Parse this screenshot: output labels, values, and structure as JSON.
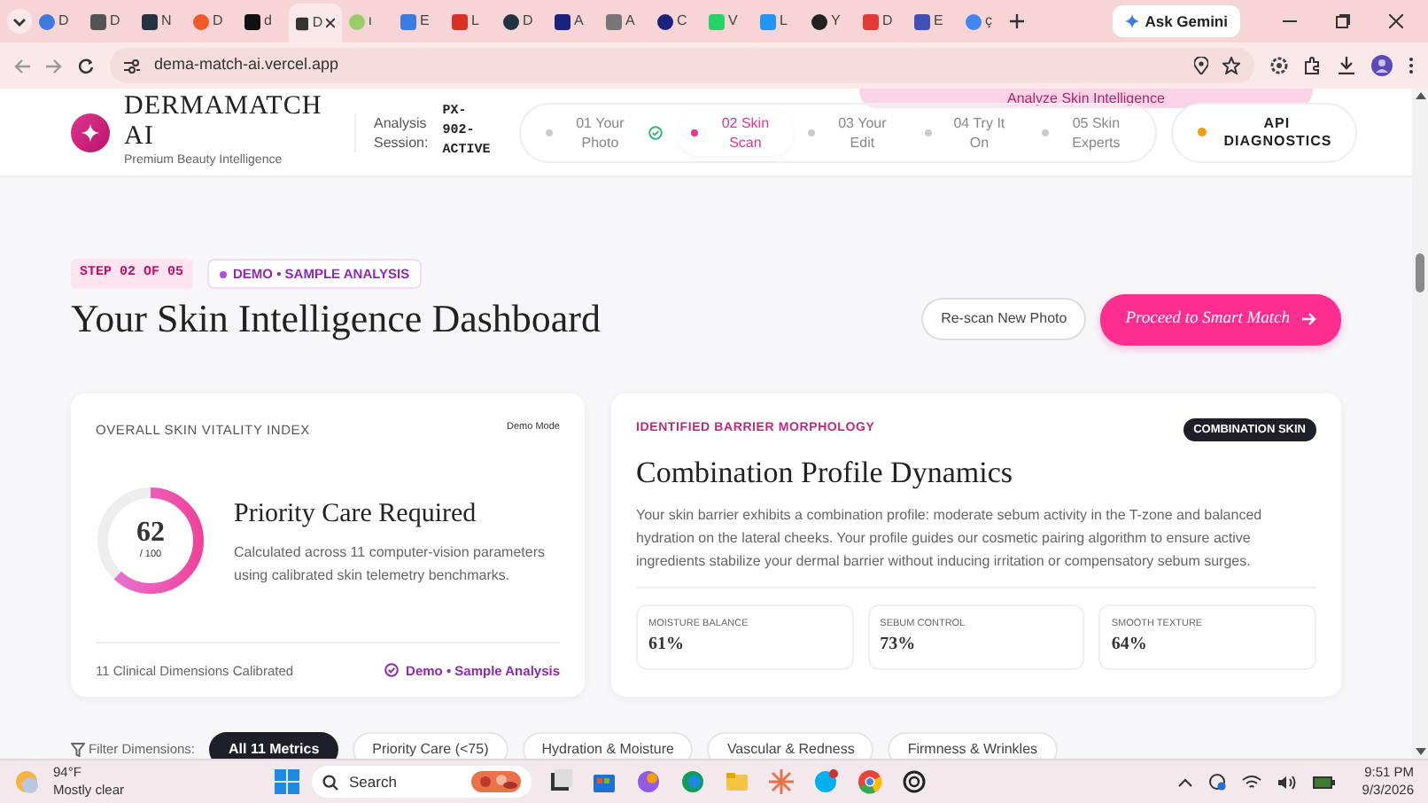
{
  "browser": {
    "tabs": [
      {
        "title": "D",
        "selected": false
      },
      {
        "title": "D",
        "selected": false
      },
      {
        "title": "N",
        "selected": false
      },
      {
        "title": "D",
        "selected": false
      },
      {
        "title": "d",
        "selected": false
      },
      {
        "title": "D",
        "selected": true
      },
      {
        "title": "ι",
        "selected": false
      },
      {
        "title": "E",
        "selected": false
      },
      {
        "title": "L",
        "selected": false
      },
      {
        "title": "D",
        "selected": false
      },
      {
        "title": "A",
        "selected": false
      },
      {
        "title": "A",
        "selected": false
      },
      {
        "title": "C",
        "selected": false
      },
      {
        "title": "V",
        "selected": false
      },
      {
        "title": "L",
        "selected": false
      },
      {
        "title": "Y",
        "selected": false
      },
      {
        "title": "D",
        "selected": false
      },
      {
        "title": "E",
        "selected": false
      },
      {
        "title": "ç",
        "selected": false
      }
    ],
    "gemini_button": "Ask Gemini",
    "url": "dema-match-ai.vercel.app"
  },
  "header": {
    "brand": "DERMAMATCH AI",
    "tagline": "Premium Beauty Intelligence",
    "session_label": "Analysis Session:",
    "session_id": "PX-902-ACTIVE",
    "ghost_button": "Analyze Skin Intelligence",
    "steps": [
      {
        "label": "01 Your Photo",
        "selected": false,
        "completed": true
      },
      {
        "label": "02 Skin Scan",
        "selected": true,
        "completed": false
      },
      {
        "label": "03 Your Edit",
        "selected": false,
        "completed": false
      },
      {
        "label": "04 Try It On",
        "selected": false,
        "completed": false
      },
      {
        "label": "05 Skin Experts",
        "selected": false,
        "completed": false
      }
    ],
    "diagnostics_button": "API DIAGNOSTICS"
  },
  "page": {
    "step_badge": "STEP 02 OF 05",
    "demo_badge": "DEMO • SAMPLE ANALYSIS",
    "title": "Your Skin Intelligence Dashboard",
    "rescan_button": "Re-scan New Photo",
    "proceed_button": "Proceed to Smart Match"
  },
  "vitality": {
    "heading": "OVERALL SKIN VITALITY INDEX",
    "mode": "Demo Mode",
    "score": "62",
    "scale": "/ 100",
    "level": 0.62,
    "status": "Priority Care Required",
    "description": "Calculated across 11 computer-vision parameters using calibrated skin telemetry benchmarks.",
    "footer": "11 Clinical Dimensions Calibrated",
    "footer_badge": "Demo • Sample Analysis"
  },
  "morphology": {
    "eyebrow": "IDENTIFIED BARRIER MORPHOLOGY",
    "badge": "COMBINATION SKIN",
    "title": "Combination Profile Dynamics",
    "description": "Your skin barrier exhibits a combination profile: moderate sebum activity in the T-zone and balanced hydration on the lateral cheeks. Your profile guides our cosmetic pairing algorithm to ensure active ingredients stabilize your dermal barrier without inducing irritation or compensatory sebum surges.",
    "metrics": [
      {
        "label": "MOISTURE BALANCE",
        "value": "61%"
      },
      {
        "label": "SEBUM CONTROL",
        "value": "73%"
      },
      {
        "label": "SMOOTH TEXTURE",
        "value": "64%"
      }
    ]
  },
  "filters": {
    "label": "Filter Dimensions:",
    "chips": [
      {
        "label": "All 11 Metrics",
        "selected": true
      },
      {
        "label": "Priority Care (<75)",
        "selected": false
      },
      {
        "label": "Hydration & Moisture",
        "selected": false
      },
      {
        "label": "Vascular & Redness",
        "selected": false
      },
      {
        "label": "Firmness & Wrinkles",
        "selected": false
      }
    ]
  },
  "taskbar": {
    "temperature": "94°F",
    "weather": "Mostly clear",
    "search": "Search",
    "time": "9:51 PM",
    "date": "9/3/2026"
  }
}
